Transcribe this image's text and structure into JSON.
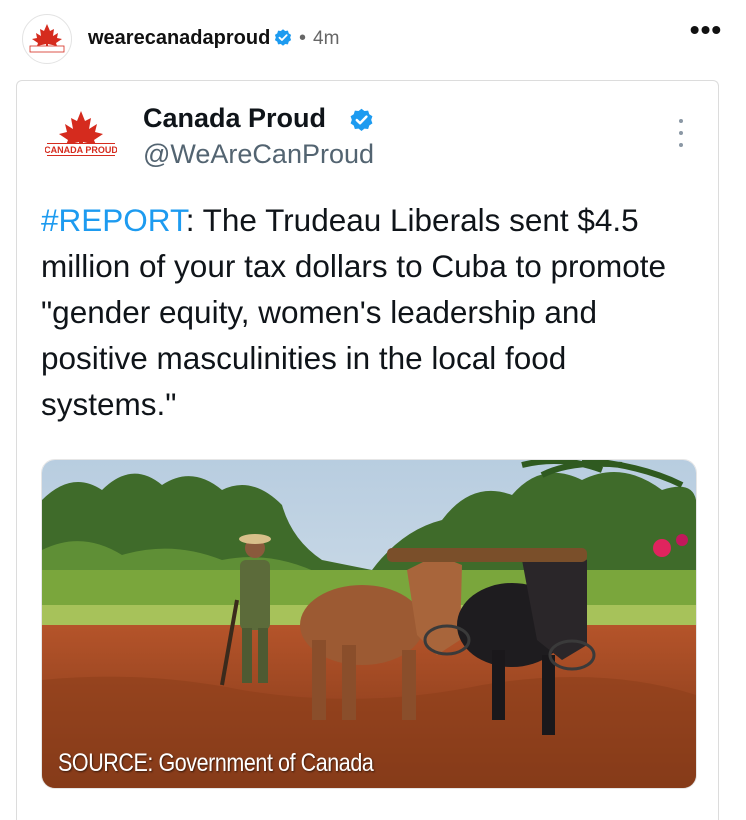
{
  "post": {
    "username": "wearecanadaproud",
    "separator": "•",
    "time_ago": "4m",
    "more_label": "•••"
  },
  "tweet": {
    "display_name": "Canada Proud",
    "handle": "@WeAreCanProud",
    "hashtag": "#REPORT",
    "body": ": The Trudeau Liberals sent $4.5 million of your tax dollars to Cuba to promote \"gender equity, women's leadership and positive masculinities in the local food systems.\"",
    "logo_text": "CANADA PROUD",
    "image_caption": "SOURCE: Government of Canada"
  },
  "icons": {
    "verified": "verified-badge-icon",
    "more": "more-horizontal-icon",
    "kebab": "more-vertical-icon",
    "logo": "maple-leaf-icon"
  },
  "colors": {
    "verified_blue": "#1d9bf0",
    "hashtag_blue": "#1d9bf0",
    "maple_red": "#d52b1e",
    "secondary_text": "#536471"
  }
}
